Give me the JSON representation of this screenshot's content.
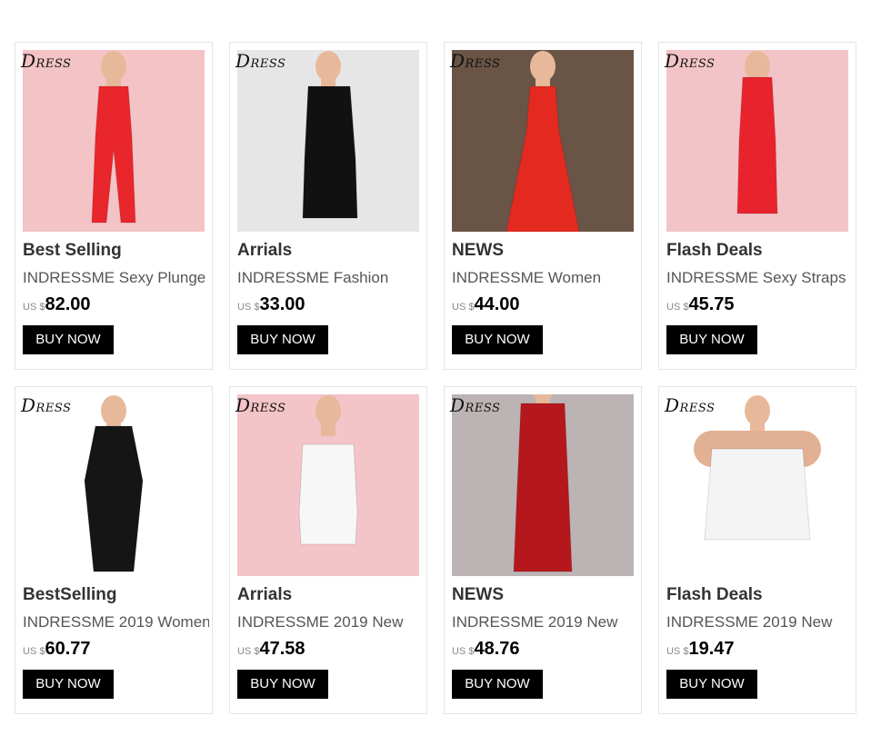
{
  "logo_text": "DRESS",
  "products": [
    {
      "category": "Best Selling",
      "name": "INDRESSME Sexy Plunge",
      "currency": "US $",
      "price": "82.00",
      "button": "BUY NOW",
      "bg": "#f3c3c6",
      "dress": "#e8262b",
      "style": "jumpsuit"
    },
    {
      "category": "Arrials",
      "name": "INDRESSME Fashion",
      "currency": "US $",
      "price": "33.00",
      "button": "BUY NOW",
      "bg": "#e6e6e6",
      "dress": "#111111",
      "style": "mini"
    },
    {
      "category": "NEWS",
      "name": "INDRESSME Women",
      "currency": "US $",
      "price": "44.00",
      "button": "BUY NOW",
      "bg": "#6a5446",
      "dress": "#e42a20",
      "style": "gown"
    },
    {
      "category": "Flash Deals",
      "name": "INDRESSME Sexy Straps",
      "currency": "US $",
      "price": "45.75",
      "button": "BUY NOW",
      "bg": "#f2c4c7",
      "dress": "#e8232d",
      "style": "midi"
    },
    {
      "category": "BestSelling",
      "name": "INDRESSME 2019 Women",
      "currency": "US $",
      "price": "60.77",
      "button": "BUY NOW",
      "bg": "#ffffff",
      "dress": "#151515",
      "style": "long-sleeve"
    },
    {
      "category": "Arrials",
      "name": "INDRESSME 2019 New",
      "currency": "US $",
      "price": "47.58",
      "button": "BUY NOW",
      "bg": "#f3c4c8",
      "dress": "#f7f7f7",
      "style": "romper"
    },
    {
      "category": "NEWS",
      "name": "INDRESSME 2019 New",
      "currency": "US $",
      "price": "48.76",
      "button": "BUY NOW",
      "bg": "#bcb4b4",
      "dress": "#b5181c",
      "style": "vest"
    },
    {
      "category": "Flash Deals",
      "name": "INDRESSME 2019 New",
      "currency": "US $",
      "price": "19.47",
      "button": "BUY NOW",
      "bg": "#ffffff",
      "dress": "#f4f4f4",
      "style": "crop"
    }
  ]
}
